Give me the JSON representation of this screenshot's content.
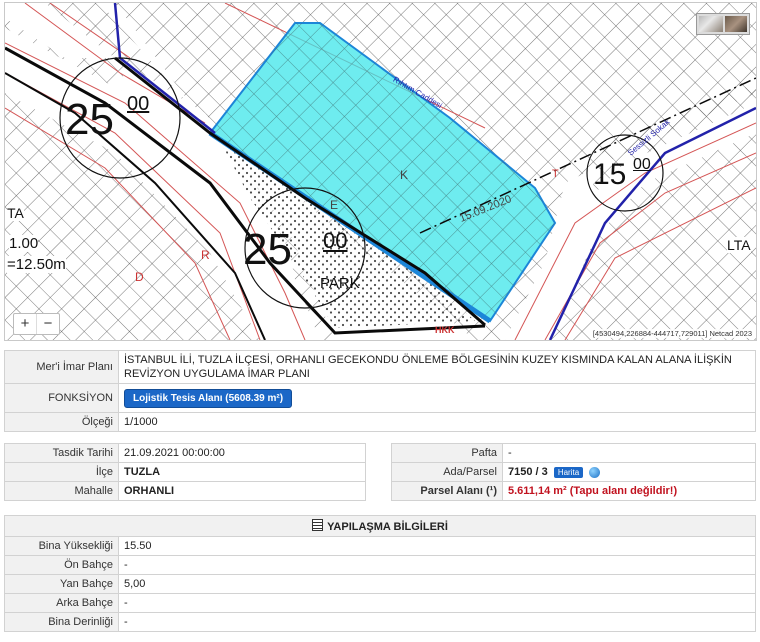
{
  "map": {
    "labels": {
      "height_a": "25",
      "height_a_sub": "00",
      "height_b": "25",
      "height_b_sub": "00",
      "height_c": "15",
      "height_c_sub": "00",
      "ta": "TA",
      "lta": "LTA",
      "ratio": "1.00",
      "hmax": "=12.50m",
      "park": "PARK",
      "k": "K",
      "e": "E",
      "r": "R",
      "d": "D",
      "hkk": "HKK",
      "date_line": "15.09.2020",
      "t": "T",
      "street": "Sessizli Sokak",
      "road": "Rıhtım Caddesi"
    },
    "zoom_in": "+",
    "zoom_out": "−",
    "coordinates": "[4530494,226884-444717,729011] Netcad 2023",
    "colors": {
      "parcel_fill": "#3ee6ea",
      "parcel_edge": "#1c86d8",
      "boundary": "#0a0a0a",
      "zoning_line": "#d44",
      "road_edge": "#2222aa"
    }
  },
  "plan": {
    "plan_label": "Mer'i İmar Planı",
    "plan_value": "İSTANBUL İLİ, TUZLA İLÇESİ, ORHANLI GECEKONDU ÖNLEME BÖLGESİNİN KUZEY KISMINDA KALAN ALANA İLİŞKİN REVİZYON UYGULAMA İMAR PLANI",
    "function_label": "FONKSİYON",
    "function_value": "Lojistik Tesis Alanı (5608.39 m²)",
    "scale_label": "Ölçeği",
    "scale_value": "1/1000"
  },
  "parcel_left": {
    "approval_label": "Tasdik Tarihi",
    "approval_value": "21.09.2021 00:00:00",
    "district_label": "İlçe",
    "district_value": "TUZLA",
    "neighborhood_label": "Mahalle",
    "neighborhood_value": "ORHANLI"
  },
  "parcel_right": {
    "pafta_label": "Pafta",
    "pafta_value": "-",
    "block_label": "Ada/Parsel",
    "block_value": "7150 / 3",
    "map_button": "Harita",
    "area_label": "Parsel Alanı (¹)",
    "area_value": "5.611,14 m² (Tapu alanı değildir!)"
  },
  "build": {
    "title": "YAPILAŞMA BİLGİLERİ",
    "rows": [
      {
        "label": "Bina Yüksekliği",
        "value": "15.50"
      },
      {
        "label": "Ön Bahçe",
        "value": "-"
      },
      {
        "label": "Yan Bahçe",
        "value": "5,00"
      },
      {
        "label": "Arka Bahçe",
        "value": "-"
      },
      {
        "label": "Bina Derinliği",
        "value": "-"
      }
    ]
  }
}
